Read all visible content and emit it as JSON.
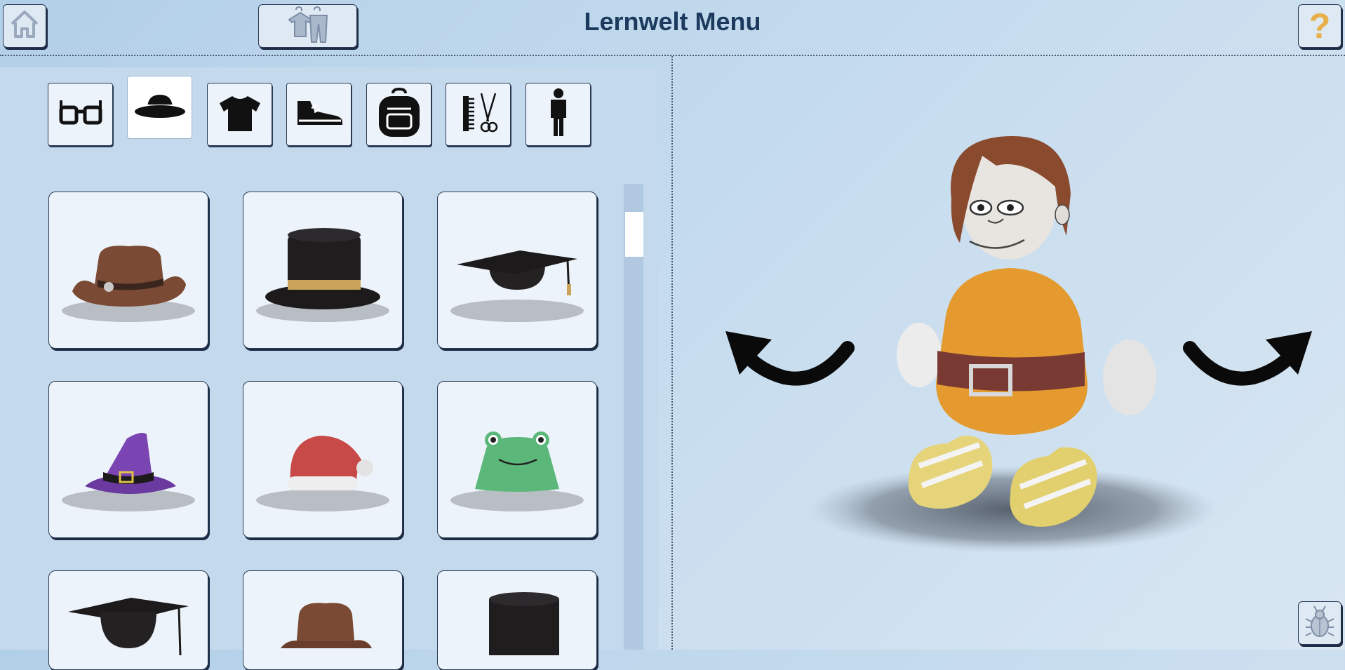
{
  "header": {
    "title": "Lernwelt Menu",
    "home_icon": "home-icon",
    "wardrobe_icon": "clothes-hanger-icon",
    "help_icon": "question-mark-icon"
  },
  "categories": [
    {
      "name": "glasses",
      "icon": "glasses-icon",
      "active": false
    },
    {
      "name": "hats",
      "icon": "hat-icon",
      "active": true
    },
    {
      "name": "shirts",
      "icon": "tshirt-icon",
      "active": false
    },
    {
      "name": "shoes",
      "icon": "shoe-icon",
      "active": false
    },
    {
      "name": "backpacks",
      "icon": "backpack-icon",
      "active": false
    },
    {
      "name": "hairstyles",
      "icon": "comb-scissors-icon",
      "active": false
    },
    {
      "name": "body",
      "icon": "person-icon",
      "active": false
    }
  ],
  "hat_items": [
    {
      "name": "cowboy-hat",
      "color": "#7a4a34"
    },
    {
      "name": "top-hat",
      "color": "#1c1a1b"
    },
    {
      "name": "graduation-cap",
      "color": "#1c1a1b"
    },
    {
      "name": "witch-hat",
      "color": "#6a3aa0"
    },
    {
      "name": "santa-hat",
      "color": "#c84a48"
    },
    {
      "name": "frog-bucket-hat",
      "color": "#5cb87a"
    },
    {
      "name": "graduation-cap",
      "color": "#1c1a1b"
    },
    {
      "name": "cowboy-hat",
      "color": "#7a4a34"
    },
    {
      "name": "top-hat",
      "color": "#1c1a1b"
    }
  ],
  "preview": {
    "rotate_left_icon": "rotate-left-arrow-icon",
    "rotate_right_icon": "rotate-right-arrow-icon",
    "avatar_colors": {
      "shirt": "#e49a2e",
      "hair": "#8a4a2e",
      "belt": "#7a3a34",
      "shoes": "#e6d47a"
    }
  },
  "footer": {
    "debug_icon": "bug-icon"
  },
  "colors": {
    "title": "#1b3a5e",
    "accent": "#e8b04a"
  }
}
